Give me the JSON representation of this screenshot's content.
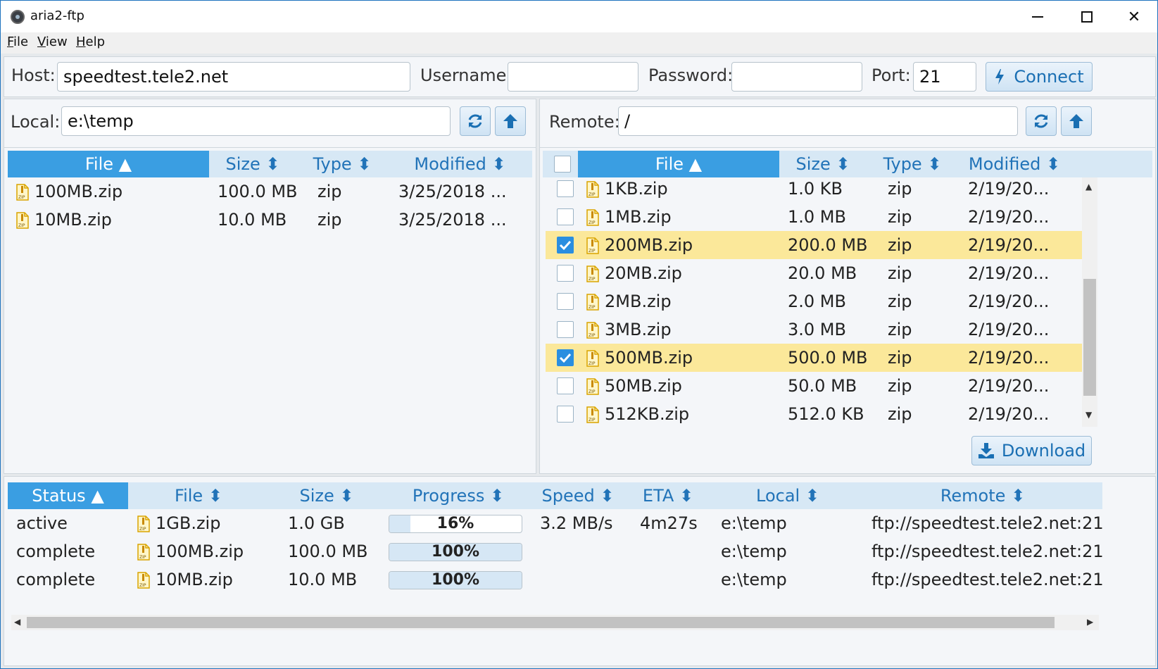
{
  "window": {
    "title": "aria2-ftp"
  },
  "menu": {
    "file": "File",
    "view": "View",
    "help": "Help"
  },
  "connection": {
    "host_label": "Host:",
    "host_value": "speedtest.tele2.net",
    "username_label": "Username:",
    "username_value": "",
    "password_label": "Password:",
    "password_value": "",
    "port_label": "Port:",
    "port_value": "21",
    "connect_label": "Connect"
  },
  "local": {
    "label": "Local:",
    "path": "e:\\temp",
    "columns": {
      "file": "File",
      "size": "Size",
      "type": "Type",
      "modified": "Modified"
    },
    "rows": [
      {
        "file": "100MB.zip",
        "size": "100.0 MB",
        "type": "zip",
        "modified": "3/25/2018 ..."
      },
      {
        "file": "10MB.zip",
        "size": "10.0 MB",
        "type": "zip",
        "modified": "3/25/2018 ..."
      }
    ]
  },
  "remote": {
    "label": "Remote:",
    "path": "/",
    "columns": {
      "file": "File",
      "size": "Size",
      "type": "Type",
      "modified": "Modified"
    },
    "rows": [
      {
        "file": "1KB.zip",
        "size": "1.0 KB",
        "type": "zip",
        "modified": "2/19/20...",
        "checked": false
      },
      {
        "file": "1MB.zip",
        "size": "1.0 MB",
        "type": "zip",
        "modified": "2/19/20...",
        "checked": false
      },
      {
        "file": "200MB.zip",
        "size": "200.0 MB",
        "type": "zip",
        "modified": "2/19/20...",
        "checked": true
      },
      {
        "file": "20MB.zip",
        "size": "20.0 MB",
        "type": "zip",
        "modified": "2/19/20...",
        "checked": false
      },
      {
        "file": "2MB.zip",
        "size": "2.0 MB",
        "type": "zip",
        "modified": "2/19/20...",
        "checked": false
      },
      {
        "file": "3MB.zip",
        "size": "3.0 MB",
        "type": "zip",
        "modified": "2/19/20...",
        "checked": false
      },
      {
        "file": "500MB.zip",
        "size": "500.0 MB",
        "type": "zip",
        "modified": "2/19/20...",
        "checked": true
      },
      {
        "file": "50MB.zip",
        "size": "50.0 MB",
        "type": "zip",
        "modified": "2/19/20...",
        "checked": false
      },
      {
        "file": "512KB.zip",
        "size": "512.0 KB",
        "type": "zip",
        "modified": "2/19/20...",
        "checked": false
      }
    ],
    "download_label": "Download"
  },
  "transfers": {
    "columns": {
      "status": "Status",
      "file": "File",
      "size": "Size",
      "progress": "Progress",
      "speed": "Speed",
      "eta": "ETA",
      "local": "Local",
      "remote": "Remote"
    },
    "rows": [
      {
        "status": "active",
        "file": "1GB.zip",
        "size": "1.0 GB",
        "progress": 0.16,
        "progress_text": "16%",
        "speed": "3.2 MB/s",
        "eta": "4m27s",
        "local": "e:\\temp",
        "remote": "ftp://speedtest.tele2.net:21..."
      },
      {
        "status": "complete",
        "file": "100MB.zip",
        "size": "100.0 MB",
        "progress": 1.0,
        "progress_text": "100%",
        "speed": "",
        "eta": "",
        "local": "e:\\temp",
        "remote": "ftp://speedtest.tele2.net:21..."
      },
      {
        "status": "complete",
        "file": "10MB.zip",
        "size": "10.0 MB",
        "progress": 1.0,
        "progress_text": "100%",
        "speed": "",
        "eta": "",
        "local": "e:\\temp",
        "remote": "ftp://speedtest.tele2.net:21..."
      }
    ]
  },
  "icons": {
    "sort_asc": "caret-up-icon",
    "sort_both": "sort-icon",
    "refresh": "refresh-icon",
    "up": "arrow-up-icon",
    "connect": "bolt-icon",
    "download": "download-icon",
    "file": "zip-file-icon"
  },
  "colors": {
    "accent": "#3a9ee2",
    "header_bg": "#d7e8f5",
    "selection": "#fbe89a",
    "link": "#2173b8"
  }
}
